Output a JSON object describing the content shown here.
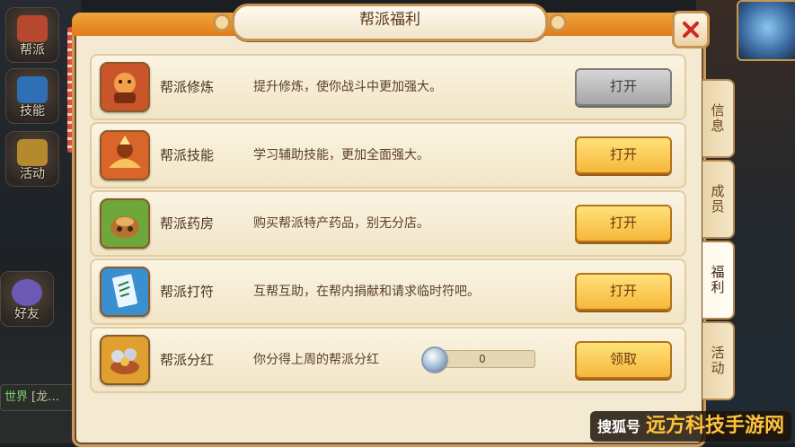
{
  "window": {
    "title": "帮派福利",
    "close_label": "✕"
  },
  "hud_left": [
    {
      "label": "帮派",
      "icon": "guild-icon",
      "color": "#b5482f"
    },
    {
      "label": "技能",
      "icon": "skill-book-icon",
      "color": "#2f6fb5"
    },
    {
      "label": "活动",
      "icon": "horn-icon",
      "color": "#b58a2f"
    },
    {
      "label": "好友",
      "icon": "friends-icon",
      "color": "#6a5ab5"
    }
  ],
  "chat": {
    "tag": "世界",
    "text": "[龙…"
  },
  "rows": [
    {
      "name": "帮派修炼",
      "desc": "提升修炼，使你战斗中更加强大。",
      "button": "打开",
      "button_enabled": false,
      "icon": "cultivation-icon",
      "icon_color": "#c8562a"
    },
    {
      "name": "帮派技能",
      "desc": "学习辅助技能，更加全面强大。",
      "button": "打开",
      "button_enabled": true,
      "icon": "skill-icon",
      "icon_color": "#d9652a"
    },
    {
      "name": "帮派药房",
      "desc": "购买帮派特产药品，别无分店。",
      "button": "打开",
      "button_enabled": true,
      "icon": "pharmacy-icon",
      "icon_color": "#6fa83a"
    },
    {
      "name": "帮派打符",
      "desc": "互帮互助，在帮内捐献和请求临时符吧。",
      "button": "打开",
      "button_enabled": true,
      "icon": "talisman-icon",
      "icon_color": "#3a8fd0"
    },
    {
      "name": "帮派分红",
      "desc": "你分得上周的帮派分红",
      "button": "领取",
      "button_enabled": true,
      "icon": "dividend-icon",
      "icon_color": "#e0a030",
      "dividend_value": "0"
    }
  ],
  "side_tabs": [
    {
      "label": "信息",
      "active": false
    },
    {
      "label": "成员",
      "active": false
    },
    {
      "label": "福利",
      "active": true
    },
    {
      "label": "活动",
      "active": false
    }
  ],
  "watermark": {
    "prefix": "搜狐号",
    "text": "远方科技手游网"
  },
  "colors": {
    "panel_bg": "#f4ead2",
    "header_orange": "#e07c19",
    "button_gold": "#f6b73a",
    "button_disabled": "#a5a5a5",
    "close_red": "#d12a1e"
  }
}
